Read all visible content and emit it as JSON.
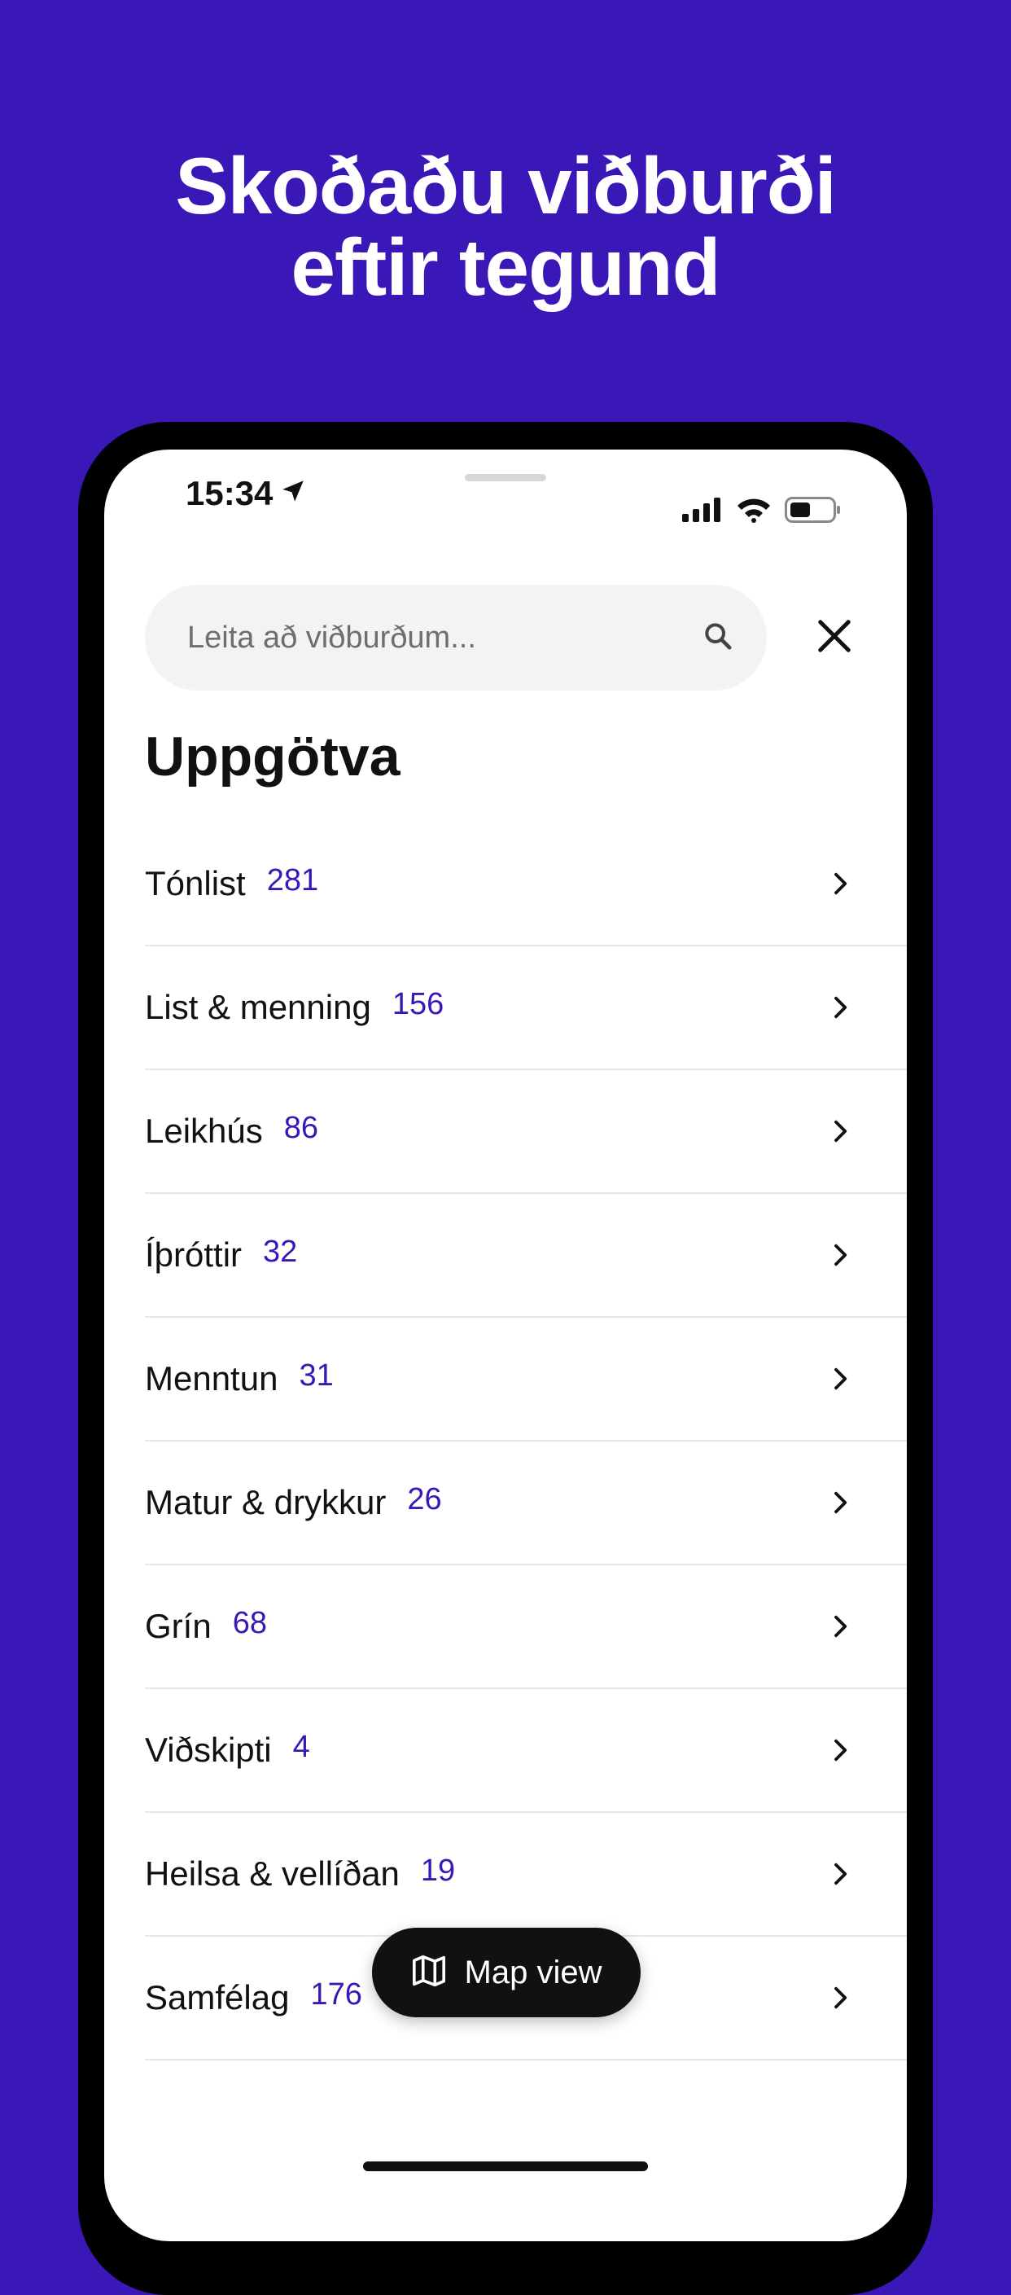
{
  "headline": {
    "line1": "Skoðaðu viðburði",
    "line2": "eftir tegund"
  },
  "status_bar": {
    "time": "15:34",
    "icons": [
      "location-arrow-icon",
      "signal-icon",
      "wifi-icon",
      "battery-icon"
    ]
  },
  "search": {
    "placeholder": "Leita að viðburðum...",
    "value": ""
  },
  "page": {
    "title": "Uppgötva"
  },
  "categories": [
    {
      "name": "Tónlist",
      "count": "281"
    },
    {
      "name": "List & menning",
      "count": "156"
    },
    {
      "name": "Leikhús",
      "count": "86"
    },
    {
      "name": "Íþróttir",
      "count": "32"
    },
    {
      "name": "Menntun",
      "count": "31"
    },
    {
      "name": "Matur & drykkur",
      "count": "26"
    },
    {
      "name": "Grín",
      "count": "68"
    },
    {
      "name": "Viðskipti",
      "count": "4"
    },
    {
      "name": "Heilsa & vellíðan",
      "count": "19"
    },
    {
      "name": "Samfélag",
      "count": "176"
    }
  ],
  "map_button": {
    "label": "Map view",
    "icon": "map-icon"
  },
  "colors": {
    "brand": "#3A18B7",
    "accent_count": "#3A18B7",
    "button_dark": "#111111"
  }
}
